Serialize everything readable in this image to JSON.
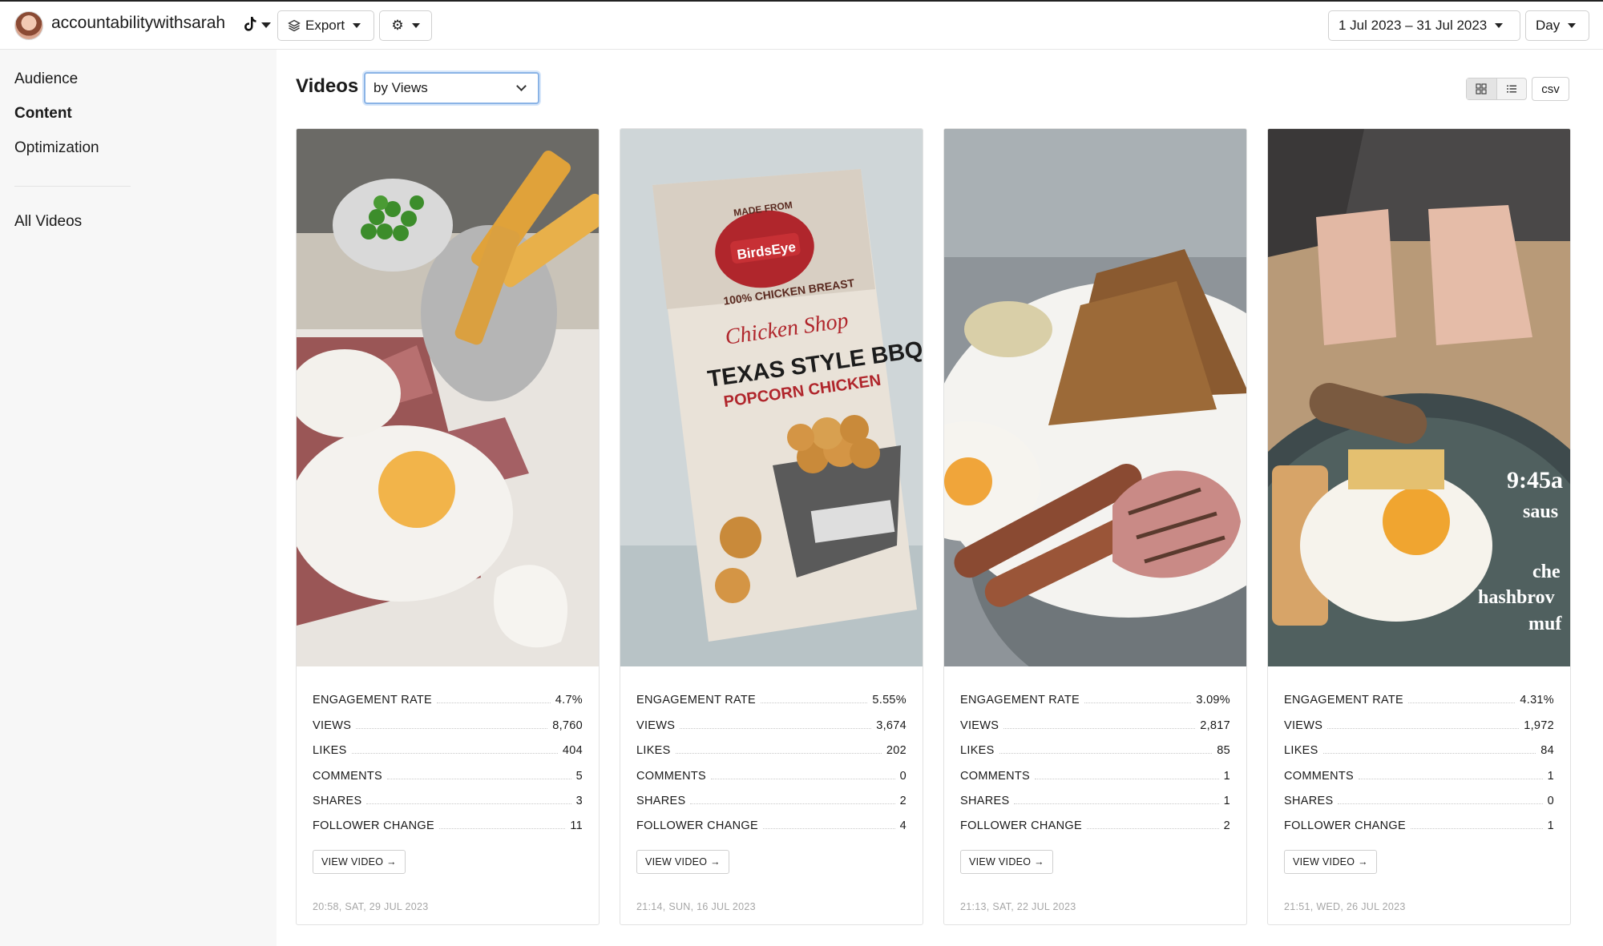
{
  "header": {
    "account_name": "accountabilitywithsarah",
    "export_label": "Export",
    "date_range": "1 Jul 2023 – 31 Jul 2023",
    "granularity": "Day"
  },
  "sidebar": {
    "items": [
      {
        "label": "Audience"
      },
      {
        "label": "Content",
        "active": true
      },
      {
        "label": "Optimization"
      },
      {
        "label": "All Videos"
      }
    ]
  },
  "main": {
    "title": "Videos",
    "sort_selected": "by Views",
    "csv_label": "csv",
    "view_button_label": "VIEW VIDEO →",
    "stat_labels": [
      "ENGAGEMENT RATE",
      "VIEWS",
      "LIKES",
      "COMMENTS",
      "SHARES",
      "FOLLOWER CHANGE"
    ],
    "videos": [
      {
        "thumbnail": "food-plate-eggs-chips-ham",
        "thumb_text": [],
        "engagement_rate": "4.7%",
        "views": "8,760",
        "likes": "404",
        "comments": "5",
        "shares": "3",
        "follower_change": "11",
        "timestamp": "20:58, SAT, 29 JUL 2023"
      },
      {
        "thumbnail": "birdseye-popcorn-chicken-box",
        "thumb_text": [
          "MADE FROM",
          "BirdsEye",
          "100% CHICKEN BREAST",
          "Chicken Shop",
          "TEXAS STYLE BBQ",
          "POPCORN CHICKEN"
        ],
        "engagement_rate": "5.55%",
        "views": "3,674",
        "likes": "202",
        "comments": "0",
        "shares": "2",
        "follower_change": "4",
        "timestamp": "21:14, SUN, 16 JUL 2023"
      },
      {
        "thumbnail": "breakfast-plate-toast-sausage",
        "thumb_text": [],
        "engagement_rate": "3.09%",
        "views": "2,817",
        "likes": "85",
        "comments": "1",
        "shares": "1",
        "follower_change": "2",
        "timestamp": "21:13, SAT, 22 JUL 2023"
      },
      {
        "thumbnail": "breakfast-plate-hands-caption",
        "thumb_text": [
          "9:45a",
          "saus",
          "che",
          "hashbrov",
          "muf"
        ],
        "engagement_rate": "4.31%",
        "views": "1,972",
        "likes": "84",
        "comments": "1",
        "shares": "0",
        "follower_change": "1",
        "timestamp": "21:51, WED, 26 JUL 2023"
      }
    ]
  },
  "colors": {
    "sidebar_bg": "#f7f7f7",
    "select_focus": "#8bb4e6",
    "timestamp_text": "#a6a6a6"
  },
  "icons": [
    "avatar",
    "tiktok-icon",
    "layers-icon",
    "gear-icon",
    "grid-view-icon",
    "list-view-icon",
    "chevron-down-icon"
  ]
}
